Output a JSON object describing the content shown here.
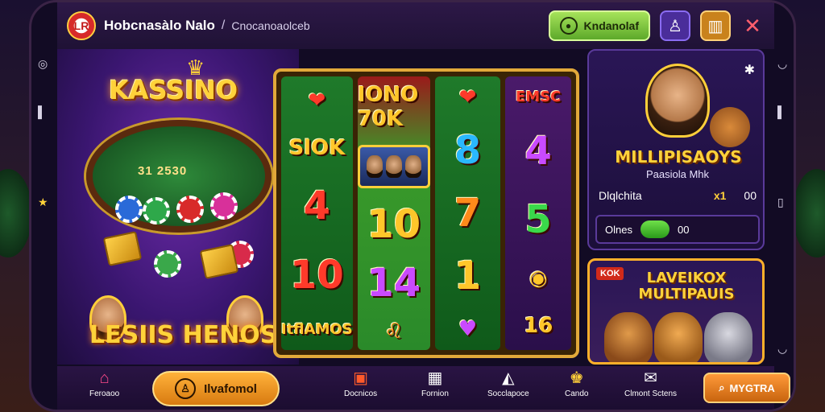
{
  "header": {
    "logo_text": "LR",
    "app_title": "Hobcnasàlo Nalo",
    "breadcrumb_sep": "/",
    "breadcrumb_sub": "Cnocanoaolceb",
    "account_button": "Kndanolaf",
    "user_icon": "user-icon",
    "box_icon": "box-icon",
    "close_icon": "close-icon"
  },
  "left": {
    "title": "KASSINO",
    "table_values": "31  2530",
    "bottom_title": "LESIIS HENOSS"
  },
  "reels": [
    {
      "symbols": [
        "lips",
        "SlOK",
        "4",
        "10",
        "ItflAMOS"
      ]
    },
    {
      "symbols": [
        "IONO 70K",
        "faces",
        "10",
        "14",
        "lion"
      ]
    },
    {
      "symbols": [
        "lips",
        "8",
        "7",
        "1",
        "heart"
      ]
    },
    {
      "symbols": [
        "EMSC",
        "4",
        "5",
        "coins",
        "16"
      ]
    }
  ],
  "right_top": {
    "title": "MILLIPISAOYS",
    "subtitle": "Paasiola Mhk",
    "row_label": "Dlqlchita",
    "row_mul": "x1",
    "row_val": "00",
    "input_label": "Olnes",
    "input_val": "00",
    "settings_icon": "settings-icon"
  },
  "right_bottom": {
    "badge": "KOK",
    "title": "LAVEIKOX MULTIPAUIS"
  },
  "nav": {
    "home": "Feroaoo",
    "cta_left": "Ilvafomol",
    "docks": "Docnicos",
    "fornon": "Fornion",
    "sociapoce": "Socclapoce",
    "cando": "Cando",
    "chat": "Clmont Sctens",
    "cta_right": "MYGTRA"
  },
  "colors": {
    "accent_gold": "#ffd23a",
    "header_bg": "#2d1847",
    "green_btn": "#a6e35a",
    "orange_btn": "#ffb23a"
  }
}
